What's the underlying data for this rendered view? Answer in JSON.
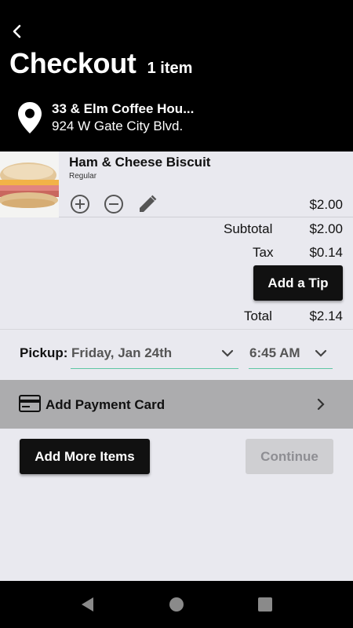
{
  "header": {
    "back_icon": "chevron-left-icon",
    "title": "Checkout",
    "item_count": "1 item",
    "store_name": "33 & Elm Coffee Hou...",
    "store_address": "924 W Gate City Blvd.",
    "location_icon": "map-pin-icon"
  },
  "item": {
    "name": "Ham & Cheese Biscuit",
    "variant": "Regular",
    "price": "$2.00",
    "icons": [
      "plus-circle-icon",
      "minus-circle-icon",
      "pencil-icon"
    ]
  },
  "totals": {
    "subtotal_label": "Subtotal",
    "subtotal_value": "$2.00",
    "tax_label": "Tax",
    "tax_value": "$0.14",
    "tip_button": "Add a Tip",
    "total_label": "Total",
    "total_value": "$2.14"
  },
  "pickup": {
    "label": "Pickup:",
    "date": "Friday, Jan 24th",
    "time": "6:45 AM",
    "underline_color": "#5fc7a4"
  },
  "payment": {
    "label": "Add Payment Card",
    "icon": "credit-card-icon",
    "chevron": "chevron-right-icon"
  },
  "actions": {
    "add_more": "Add More Items",
    "continue": "Continue"
  },
  "navbar": {
    "icons": [
      "back-triangle-icon",
      "home-circle-icon",
      "recents-square-icon"
    ]
  }
}
